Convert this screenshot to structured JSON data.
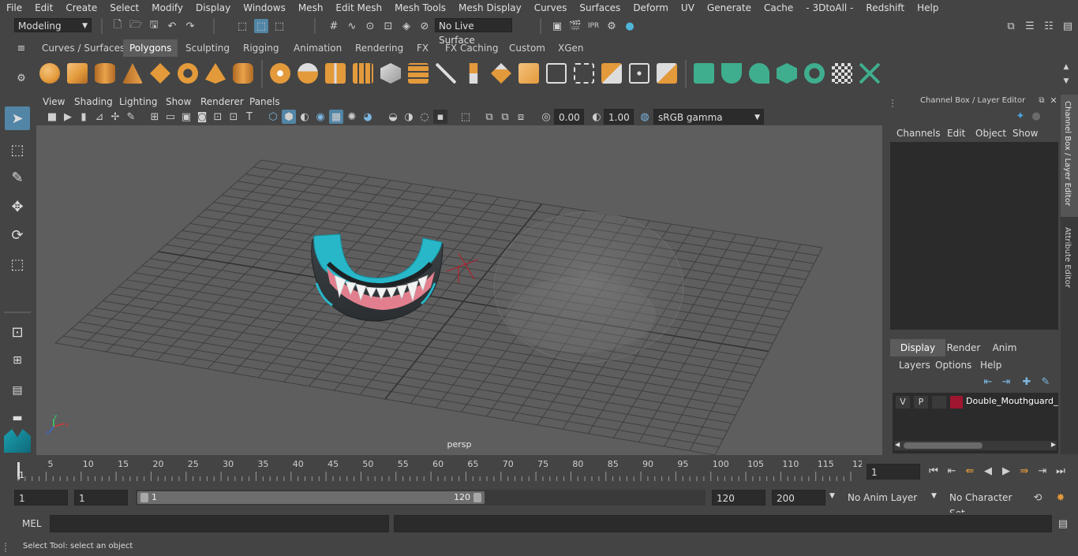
{
  "menu": [
    "File",
    "Edit",
    "Create",
    "Select",
    "Modify",
    "Display",
    "Windows",
    "Mesh",
    "Edit Mesh",
    "Mesh Tools",
    "Mesh Display",
    "Curves",
    "Surfaces",
    "Deform",
    "UV",
    "Generate",
    "Cache",
    "- 3DtoAll -",
    "Redshift",
    "Help"
  ],
  "status": {
    "mode": "Modeling",
    "live_surface": "No Live Surface"
  },
  "shelf_tabs": [
    "Curves / Surfaces",
    "Polygons",
    "Sculpting",
    "Rigging",
    "Animation",
    "Rendering",
    "FX",
    "FX Caching",
    "Custom",
    "XGen"
  ],
  "shelf_active": "Polygons",
  "viewport": {
    "menus": [
      "View",
      "Shading",
      "Lighting",
      "Show",
      "Renderer",
      "Panels"
    ],
    "exposure": "0.00",
    "gamma": "1.00",
    "color_space": "sRGB gamma",
    "camera": "persp"
  },
  "channel_box": {
    "title": "Channel Box / Layer Editor",
    "menus": [
      "Channels",
      "Edit",
      "Object",
      "Show"
    ],
    "layer_tabs": [
      "Display",
      "Render",
      "Anim"
    ],
    "layer_active": "Display",
    "layer_menus": [
      "Layers",
      "Options",
      "Help"
    ],
    "layer": {
      "v": "V",
      "p": "P",
      "name": "Double_Mouthguard_"
    },
    "side_tabs": [
      "Channel Box / Layer Editor",
      "Attribute Editor"
    ]
  },
  "timeline": {
    "ticks": [
      "5",
      "10",
      "15",
      "20",
      "25",
      "30",
      "35",
      "40",
      "45",
      "50",
      "55",
      "60",
      "65",
      "70",
      "75",
      "80",
      "85",
      "90",
      "95",
      "100",
      "105",
      "110",
      "115",
      "12"
    ],
    "start_mark": "1",
    "current_frame": "1"
  },
  "range": {
    "start": "1",
    "playback_start": "1",
    "slider_start": "1",
    "slider_end": "120",
    "playback_end": "120",
    "end": "200",
    "anim_layer": "No Anim Layer",
    "character_set": "No Character Set"
  },
  "command": {
    "language": "MEL"
  },
  "help_line": "Select Tool: select an object",
  "colors": {
    "accent": "#5285a6",
    "layer_color": "#a0152f",
    "shelf_orange": "#e39a3b",
    "shelf_green": "#3fae8e"
  }
}
